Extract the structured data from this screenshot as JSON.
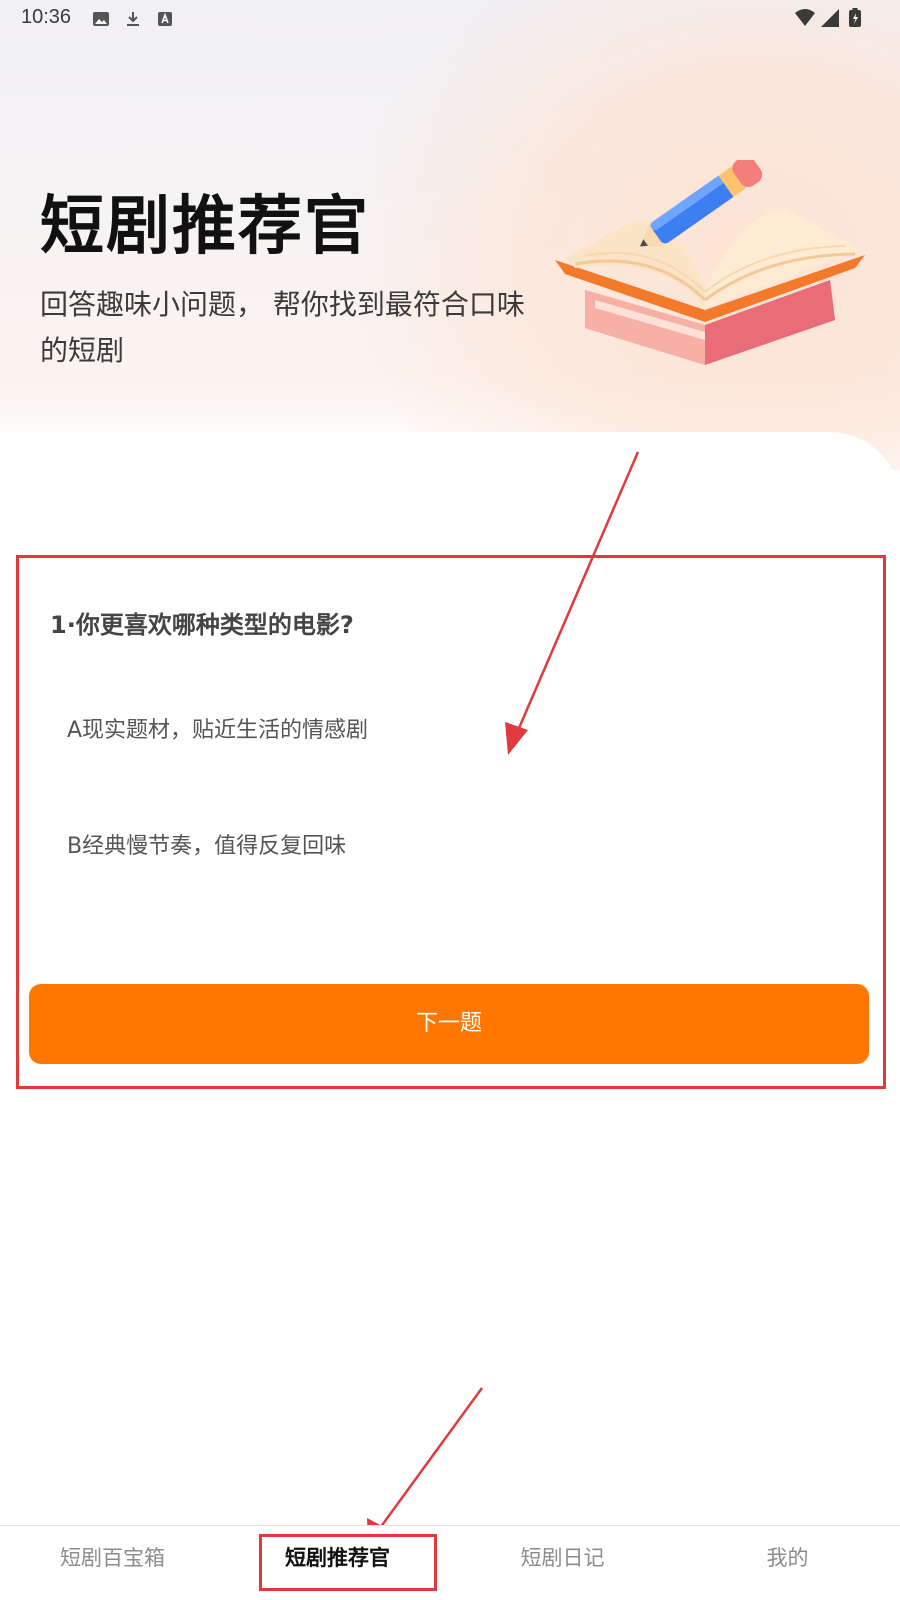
{
  "status_bar": {
    "time": "10:36",
    "left_icons": [
      "image-icon",
      "download-icon",
      "keyboard-a-icon"
    ],
    "right_icons": [
      "wifi-icon",
      "signal-icon",
      "battery-charging-icon"
    ]
  },
  "hero": {
    "title": "短剧推荐官",
    "subtitle": "回答趣味小问题， 帮你找到最符合口味的短剧",
    "illustration": "book-pencil-illustration"
  },
  "quiz": {
    "question": "1·你更喜欢哪种类型的电影?",
    "options": [
      {
        "label": "A现实题材，贴近生活的情感剧"
      },
      {
        "label": "B经典慢节奏，值得反复回味"
      }
    ],
    "next_label": "下一题"
  },
  "bottom_nav": {
    "items": [
      {
        "label": "短剧百宝箱",
        "active": false
      },
      {
        "label": "短剧推荐官",
        "active": true
      },
      {
        "label": "短剧日记",
        "active": false
      },
      {
        "label": "我的",
        "active": false
      }
    ]
  },
  "colors": {
    "accent": "#ff7700",
    "annotation": "#e03a3f",
    "text_primary": "#111111",
    "text_muted": "#8c8c8c"
  }
}
